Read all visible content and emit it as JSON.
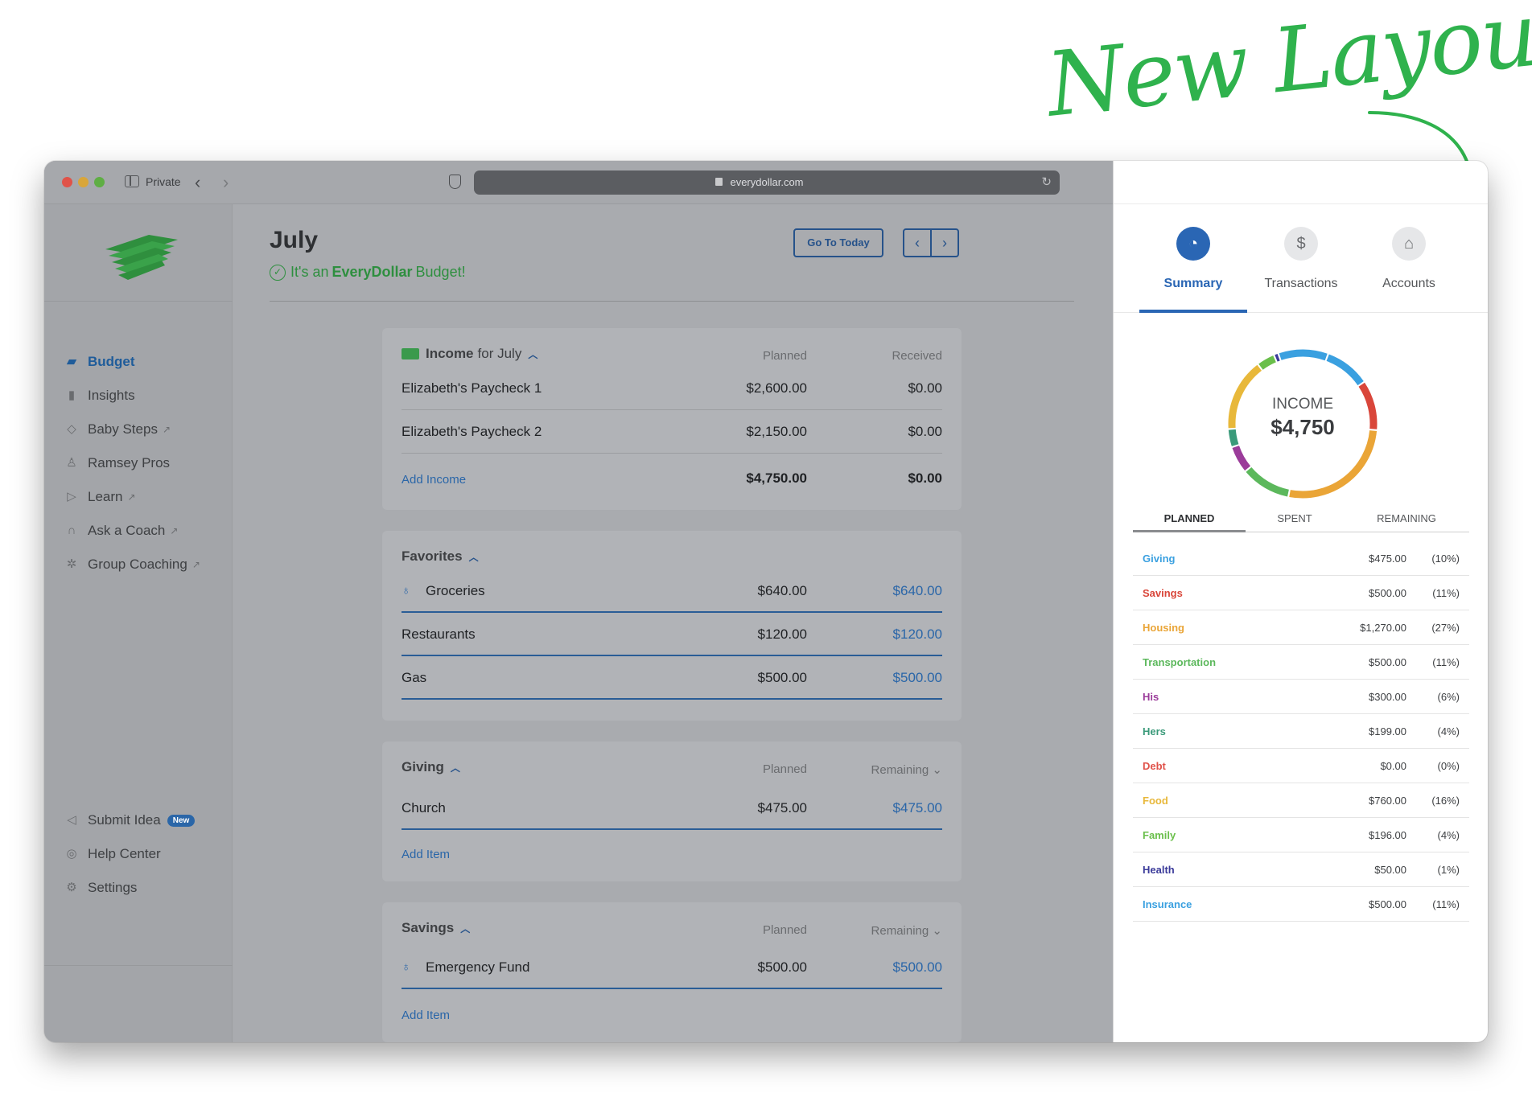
{
  "headline": "New Layout",
  "browser": {
    "private_label": "Private",
    "url": "everydollar.com"
  },
  "nav": {
    "items": [
      {
        "label": "Budget"
      },
      {
        "label": "Insights"
      },
      {
        "label": "Baby Steps"
      },
      {
        "label": "Ramsey Pros"
      },
      {
        "label": "Learn"
      },
      {
        "label": "Ask a Coach"
      },
      {
        "label": "Group Coaching"
      }
    ],
    "bottom_items": [
      {
        "label": "Submit Idea",
        "badge": "New"
      },
      {
        "label": "Help Center"
      },
      {
        "label": "Settings"
      }
    ]
  },
  "header": {
    "month": "July",
    "tagline_prefix": "It's an",
    "tagline_brand": "EveryDollar",
    "tagline_suffix": "Budget!",
    "go_today": "Go To Today"
  },
  "income": {
    "title": "Income",
    "title_suffix": "for July",
    "col_planned": "Planned",
    "col_received": "Received",
    "rows": [
      {
        "name": "Elizabeth's Paycheck 1",
        "planned": "$2,600.00",
        "received": "$0.00"
      },
      {
        "name": "Elizabeth's Paycheck 2",
        "planned": "$2,150.00",
        "received": "$0.00"
      }
    ],
    "add_label": "Add Income",
    "total_planned": "$4,750.00",
    "total_received": "$0.00"
  },
  "favorites": {
    "title": "Favorites",
    "rows": [
      {
        "name": "Groceries",
        "planned": "$640.00",
        "remaining": "$640.00"
      },
      {
        "name": "Restaurants",
        "planned": "$120.00",
        "remaining": "$120.00"
      },
      {
        "name": "Gas",
        "planned": "$500.00",
        "remaining": "$500.00"
      }
    ]
  },
  "giving": {
    "title": "Giving",
    "col_planned": "Planned",
    "col_remaining": "Remaining",
    "rows": [
      {
        "name": "Church",
        "planned": "$475.00",
        "remaining": "$475.00"
      }
    ],
    "add_label": "Add Item"
  },
  "savings": {
    "title": "Savings",
    "col_planned": "Planned",
    "col_remaining": "Remaining",
    "rows": [
      {
        "name": "Emergency Fund",
        "planned": "$500.00",
        "remaining": "$500.00"
      }
    ],
    "add_label": "Add Item"
  },
  "panel": {
    "tabs": [
      {
        "label": "Summary",
        "icon": "summary-icon"
      },
      {
        "label": "Transactions",
        "icon": "dollar-icon"
      },
      {
        "label": "Accounts",
        "icon": "bank-icon"
      }
    ],
    "donut_label": "INCOME",
    "donut_value": "$4,750",
    "summary_tabs": {
      "planned": "PLANNED",
      "spent": "SPENT",
      "remaining": "REMAINING"
    },
    "categories": [
      {
        "name": "Giving",
        "amount": "$475.00",
        "pct": "(10%)",
        "color": "#3aa0e0",
        "share": 10
      },
      {
        "name": "Savings",
        "amount": "$500.00",
        "pct": "(11%)",
        "color": "#d9463a",
        "share": 11
      },
      {
        "name": "Housing",
        "amount": "$1,270.00",
        "pct": "(27%)",
        "color": "#eaa537",
        "share": 27
      },
      {
        "name": "Transportation",
        "amount": "$500.00",
        "pct": "(11%)",
        "color": "#5cb85c",
        "share": 11
      },
      {
        "name": "His",
        "amount": "$300.00",
        "pct": "(6%)",
        "color": "#9b3c9a",
        "share": 6
      },
      {
        "name": "Hers",
        "amount": "$199.00",
        "pct": "(4%)",
        "color": "#3a9a7a",
        "share": 4
      },
      {
        "name": "Debt",
        "amount": "$0.00",
        "pct": "(0%)",
        "color": "#e0524a",
        "share": 0
      },
      {
        "name": "Food",
        "amount": "$760.00",
        "pct": "(16%)",
        "color": "#e8b83a",
        "share": 16
      },
      {
        "name": "Family",
        "amount": "$196.00",
        "pct": "(4%)",
        "color": "#6abf4b",
        "share": 4
      },
      {
        "name": "Health",
        "amount": "$50.00",
        "pct": "(1%)",
        "color": "#3b3b9a",
        "share": 1
      },
      {
        "name": "Insurance",
        "amount": "$500.00",
        "pct": "(11%)",
        "color": "#3aa0e0",
        "share": 11
      }
    ]
  }
}
